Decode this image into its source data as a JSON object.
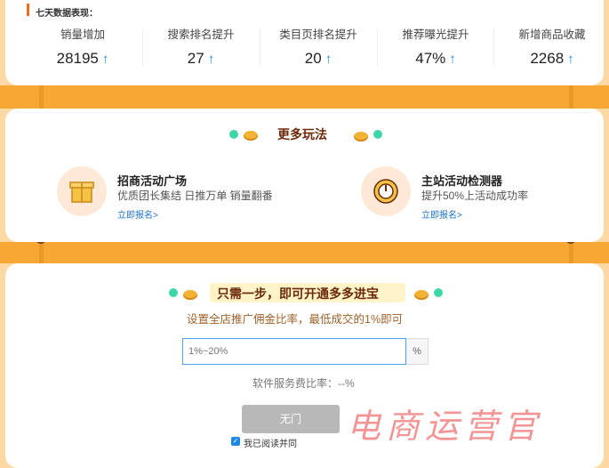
{
  "stats": {
    "title": "七天数据表现：",
    "items": [
      {
        "label": "销量增加",
        "value": "28195"
      },
      {
        "label": "搜索排名提升",
        "value": "27"
      },
      {
        "label": "类目页排名提升",
        "value": "20"
      },
      {
        "label": "推荐曝光提升",
        "value": "47%"
      },
      {
        "label": "新增商品收藏",
        "value": "2268"
      }
    ],
    "arrow": "↑"
  },
  "more": {
    "title": "更多玩法",
    "cards": [
      {
        "title": "招商活动广场",
        "desc": "优质团长集结 日推万单 销量翻番",
        "link": "立即报名>"
      },
      {
        "title": "主站活动检测器",
        "desc": "提升50%上活动成功率",
        "link": "立即报名>"
      }
    ]
  },
  "setup": {
    "title": "只需一步，即可开通多多进宝",
    "subtitle": "设置全店推广佣金比率，最低成交的1%即可",
    "input_placeholder": "1%~20%",
    "input_suffix": "%",
    "service_fee": "软件服务费比率：--%",
    "submit_label": "无门",
    "agree_text": "我已阅读并同"
  },
  "watermark": "电商运营官",
  "colors": {
    "accent_orange": "#f7a733",
    "brand_brown": "#6b2a0a",
    "link_blue": "#1e73c8",
    "arrow_blue": "#1e88e5"
  }
}
